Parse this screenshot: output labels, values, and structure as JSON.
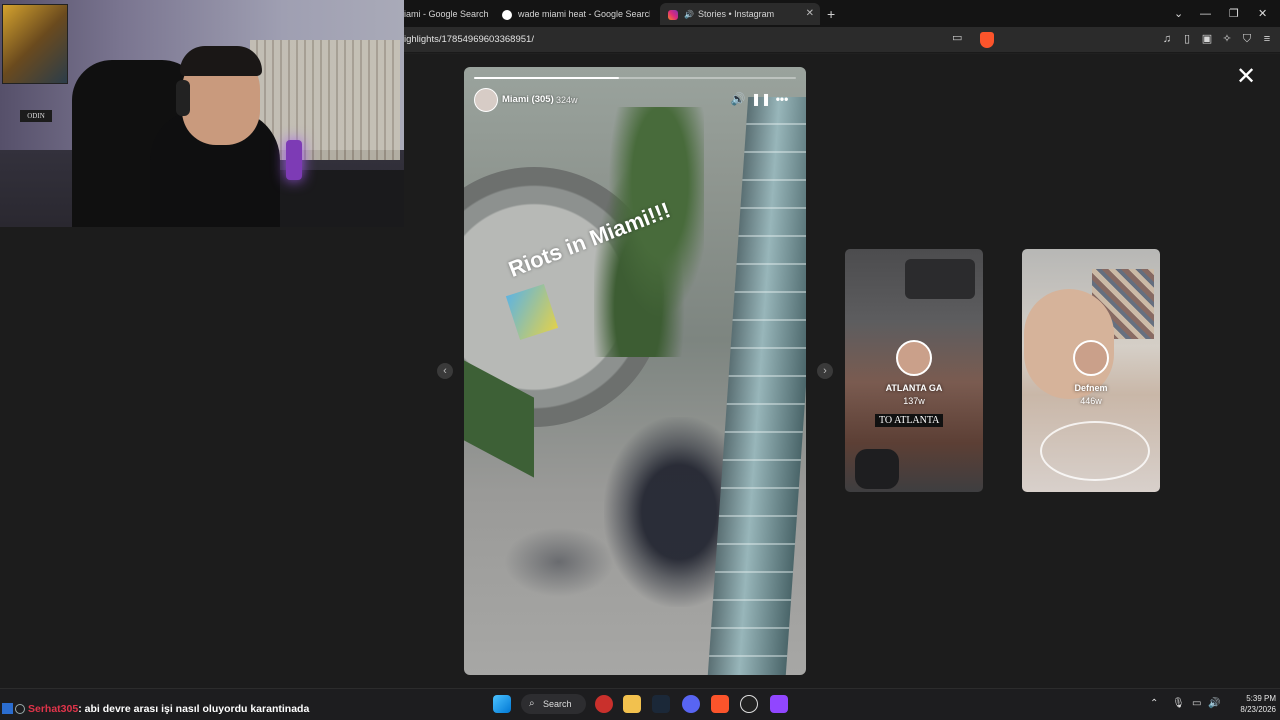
{
  "browser": {
    "tabs": [
      {
        "label": "iami - Google Search",
        "active": false
      },
      {
        "label": "wade miami heat - Google Search",
        "active": false
      },
      {
        "label": "Stories • Instagram",
        "active": true
      }
    ],
    "url": "ighlights/17854969603368951/"
  },
  "story": {
    "author": "Miami (305)",
    "age": "324w",
    "caption": "Riots in Miami!!!",
    "progress": 0.45
  },
  "previews": [
    {
      "name": "ATLANTA GA",
      "age": "137w",
      "overlay_text": "TO ATLANTA"
    },
    {
      "name": "Defnem",
      "age": "446w"
    }
  ],
  "webcam": {
    "sign_text": "ODIN"
  },
  "chat": {
    "username": "Serhat305",
    "message": ": abi devre arası işi nasıl oluyordu karantinada"
  },
  "taskbar": {
    "search_label": "Search",
    "time": "5:39 PM",
    "date": "8/23/2026"
  }
}
